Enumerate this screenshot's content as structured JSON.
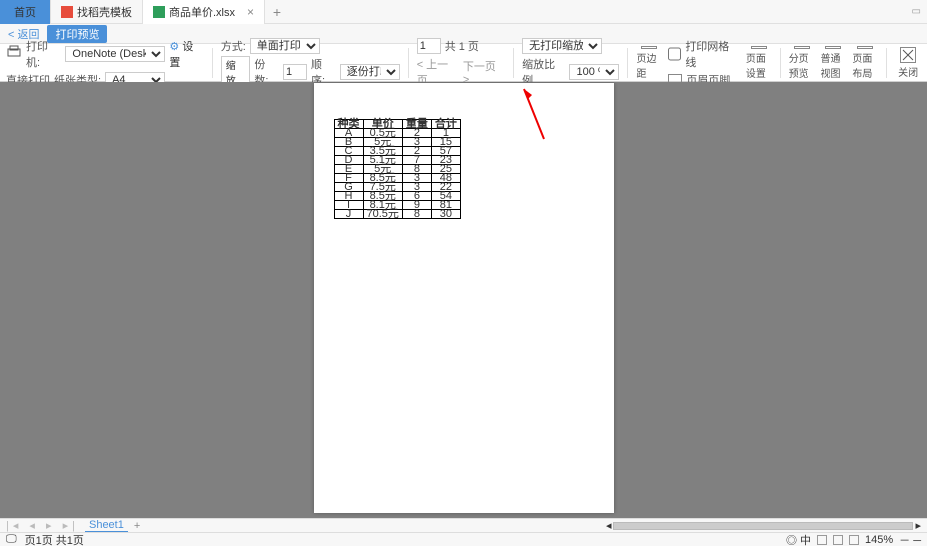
{
  "tabs": {
    "home": "首页",
    "pdf": "找稻壳模板",
    "file": "商品单价.xlsx"
  },
  "sub": {
    "back": "< 返回",
    "chip": "打印预览"
  },
  "tb": {
    "printer": "打印机:",
    "printer_val": "OneNote (Desktop)",
    "settings": "设置",
    "direct": "直接打印",
    "paper": "纸张类型:",
    "paper_val": "A4",
    "mode": "方式:",
    "mode_val": "单面打印",
    "zoom": "缩放",
    "copies": "份数:",
    "copies_val": "1",
    "order": "顺序:",
    "order_val": "逐份打印",
    "page_of": "共 1 页",
    "prev": "< 上一页",
    "next": "下一页 >",
    "scale_opt": "无打印缩放",
    "ratio": "缩放比例",
    "ratio_val": "100 %",
    "margin": "页边距",
    "gridline": "打印网格线",
    "header": "页眉页脚",
    "pagesetup": "页面设置",
    "pagebreak": "分页预览",
    "normal": "普通视图",
    "layout": "页面布局",
    "close": "关闭"
  },
  "table": {
    "headers": [
      "种类",
      "单价",
      "重量",
      "合计"
    ],
    "rows": [
      [
        "A",
        "0.5元",
        "2",
        "1"
      ],
      [
        "B",
        "5元",
        "3",
        "15"
      ],
      [
        "C",
        "3.5元",
        "2",
        "57"
      ],
      [
        "D",
        "5.1元",
        "7",
        "23"
      ],
      [
        "E",
        "5元",
        "8",
        "25"
      ],
      [
        "F",
        "8.5元",
        "3",
        "48"
      ],
      [
        "G",
        "7.5元",
        "3",
        "22"
      ],
      [
        "H",
        "8.5元",
        "6",
        "54"
      ],
      [
        "I",
        "8.1元",
        "9",
        "81"
      ],
      [
        "J",
        "70.5元",
        "8",
        "30"
      ]
    ]
  },
  "sheet": {
    "name": "Sheet1"
  },
  "status": {
    "pages": "页1页 共1页",
    "zoom": "145%"
  }
}
